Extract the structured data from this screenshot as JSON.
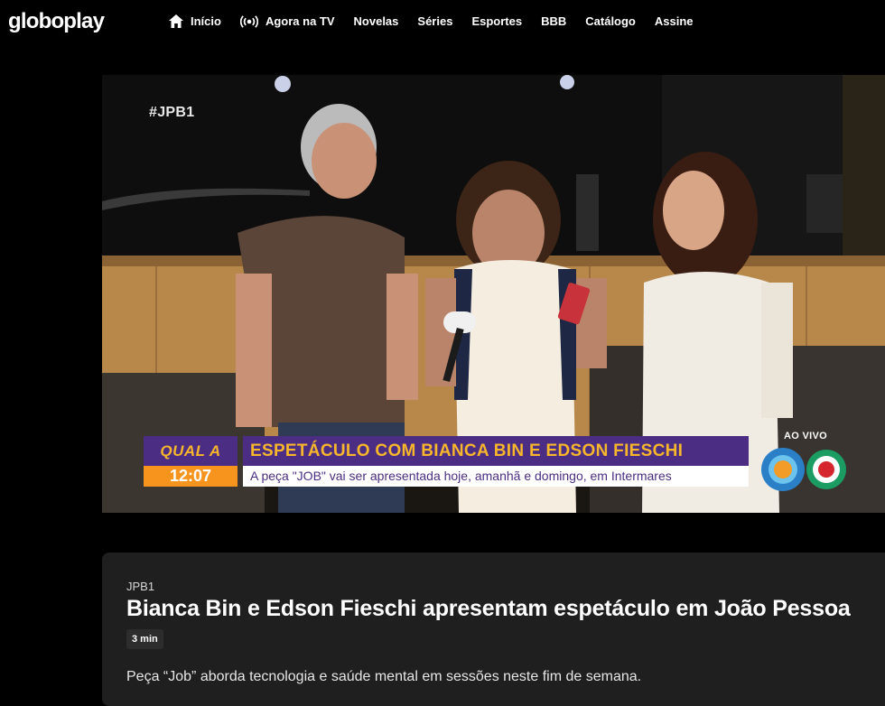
{
  "header": {
    "logo": "globoplay",
    "nav": [
      {
        "label": "Início",
        "icon": "home-icon"
      },
      {
        "label": "Agora na TV",
        "icon": "broadcast-icon"
      },
      {
        "label": "Novelas"
      },
      {
        "label": "Séries"
      },
      {
        "label": "Esportes"
      },
      {
        "label": "BBB"
      },
      {
        "label": "Catálogo"
      },
      {
        "label": "Assine"
      }
    ]
  },
  "video": {
    "hashtag": "#JPB1",
    "segment_label": "QUAL A BOA?",
    "time": "12:07",
    "headline": "ESPETÁCULO COM BIANCA BIN E EDSON FIESCHI",
    "subheadline": "A peça \"JOB\" vai ser apresentada hoje, amanhã e domingo, em Intermares",
    "live_label": "AO VIVO",
    "colors": {
      "purple": "#4b2e83",
      "orange": "#f7941d",
      "yellow": "#f7b62b"
    }
  },
  "info": {
    "program": "JPB1",
    "title": "Bianca Bin e Edson Fieschi apresentam espetáculo em João Pessoa",
    "duration": "3 min",
    "description": "Peça “Job” aborda tecnologia e saúde mental em sessões neste fim de semana."
  }
}
